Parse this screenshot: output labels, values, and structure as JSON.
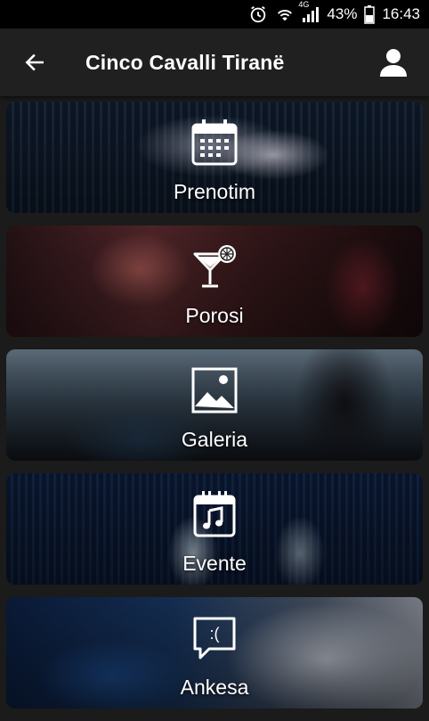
{
  "status_bar": {
    "battery_percent": "43%",
    "time": "16:43",
    "network": "4G",
    "icons": [
      "alarm-icon",
      "wifi-icon",
      "signal-icon",
      "battery-icon"
    ]
  },
  "app_bar": {
    "title": "Cinco Cavalli Tiranë",
    "back_icon": "arrow-left-icon",
    "profile_icon": "user-icon"
  },
  "menu": [
    {
      "label": "Prenotim",
      "icon": "calendar-icon"
    },
    {
      "label": "Porosi",
      "icon": "cocktail-icon"
    },
    {
      "label": "Galeria",
      "icon": "image-icon"
    },
    {
      "label": "Evente",
      "icon": "music-calendar-icon"
    },
    {
      "label": "Ankesa",
      "icon": "sad-chat-icon",
      "icon_text": ":("
    }
  ]
}
